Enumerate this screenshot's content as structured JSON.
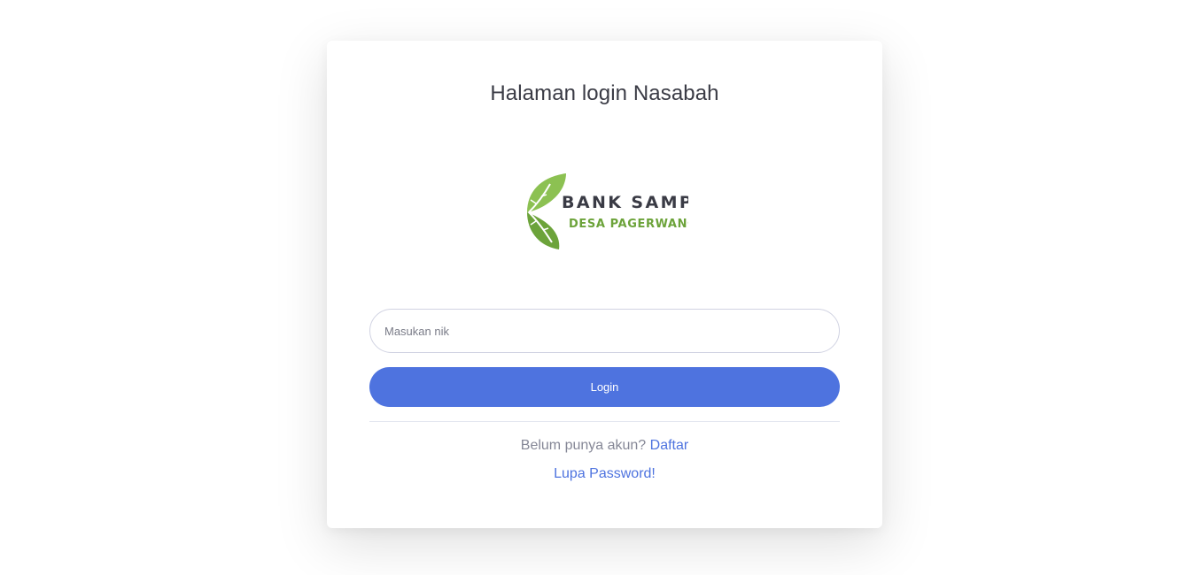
{
  "page": {
    "title": "Halaman login Nasabah"
  },
  "logo": {
    "line1": "BANK SAMPAH",
    "line2": "DESA PAGERWANGI",
    "leaf_color_light": "#8cc152",
    "leaf_color_dark": "#6ca33a",
    "text_color_dark": "#3a3b45",
    "text_color_green": "#6ca33a"
  },
  "form": {
    "nik_placeholder": "Masukan nik",
    "nik_value": "",
    "login_label": "Login"
  },
  "footer": {
    "register_prompt": "Belum punya akun? ",
    "register_link": "Daftar",
    "forgot_link": "Lupa Password!"
  },
  "colors": {
    "primary": "#4e73df",
    "muted_text": "#858796",
    "border": "#d1d3e2"
  }
}
